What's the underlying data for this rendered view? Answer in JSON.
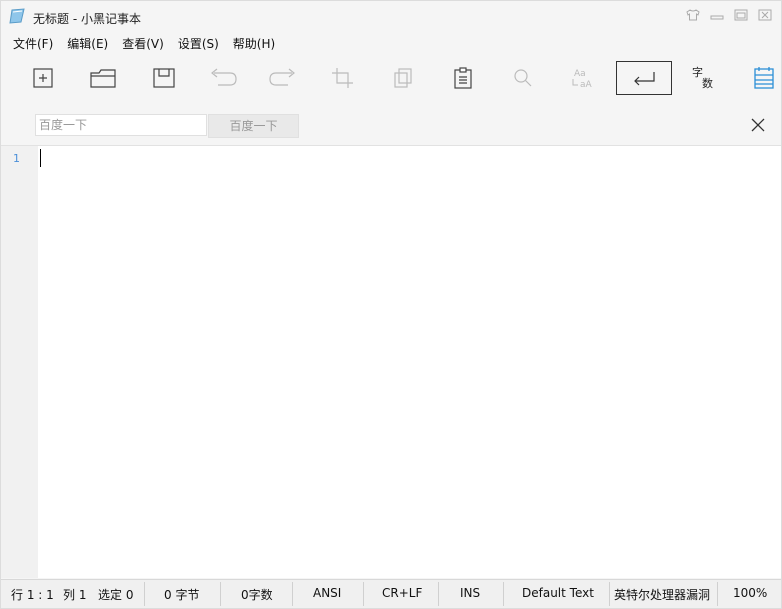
{
  "window": {
    "title": "无标题 - 小黑记事本"
  },
  "menu": [
    {
      "label": "文件(F)"
    },
    {
      "label": "编辑(E)"
    },
    {
      "label": "查看(V)"
    },
    {
      "label": "设置(S)"
    },
    {
      "label": "帮助(H)"
    }
  ],
  "toolbar": {
    "icons": [
      "new-icon",
      "open-icon",
      "save-icon",
      "undo-icon",
      "redo-icon",
      "crop-icon",
      "copy-icon",
      "clipboard-icon",
      "search-icon",
      "font-case-icon",
      "wrap-icon",
      "word-count-icon",
      "menu-icon"
    ],
    "word_count_top": "字",
    "word_count_bottom": "数"
  },
  "search": {
    "placeholder": "百度一下",
    "button_label": "百度一下"
  },
  "editor": {
    "line_numbers": [
      "1"
    ]
  },
  "status": {
    "position": "行 1 : 1",
    "column": "列 1",
    "selected": "选定 0",
    "bytes": "0 字节",
    "chars": "0字数",
    "encoding": "ANSI",
    "line_ending": "CR+LF",
    "mode": "INS",
    "syntax": "Default Text",
    "notice": "英特尔处理器漏洞",
    "zoom": "100%"
  },
  "colors": {
    "accent": "#2b8fd6",
    "line_number": "#4a8fd8"
  }
}
